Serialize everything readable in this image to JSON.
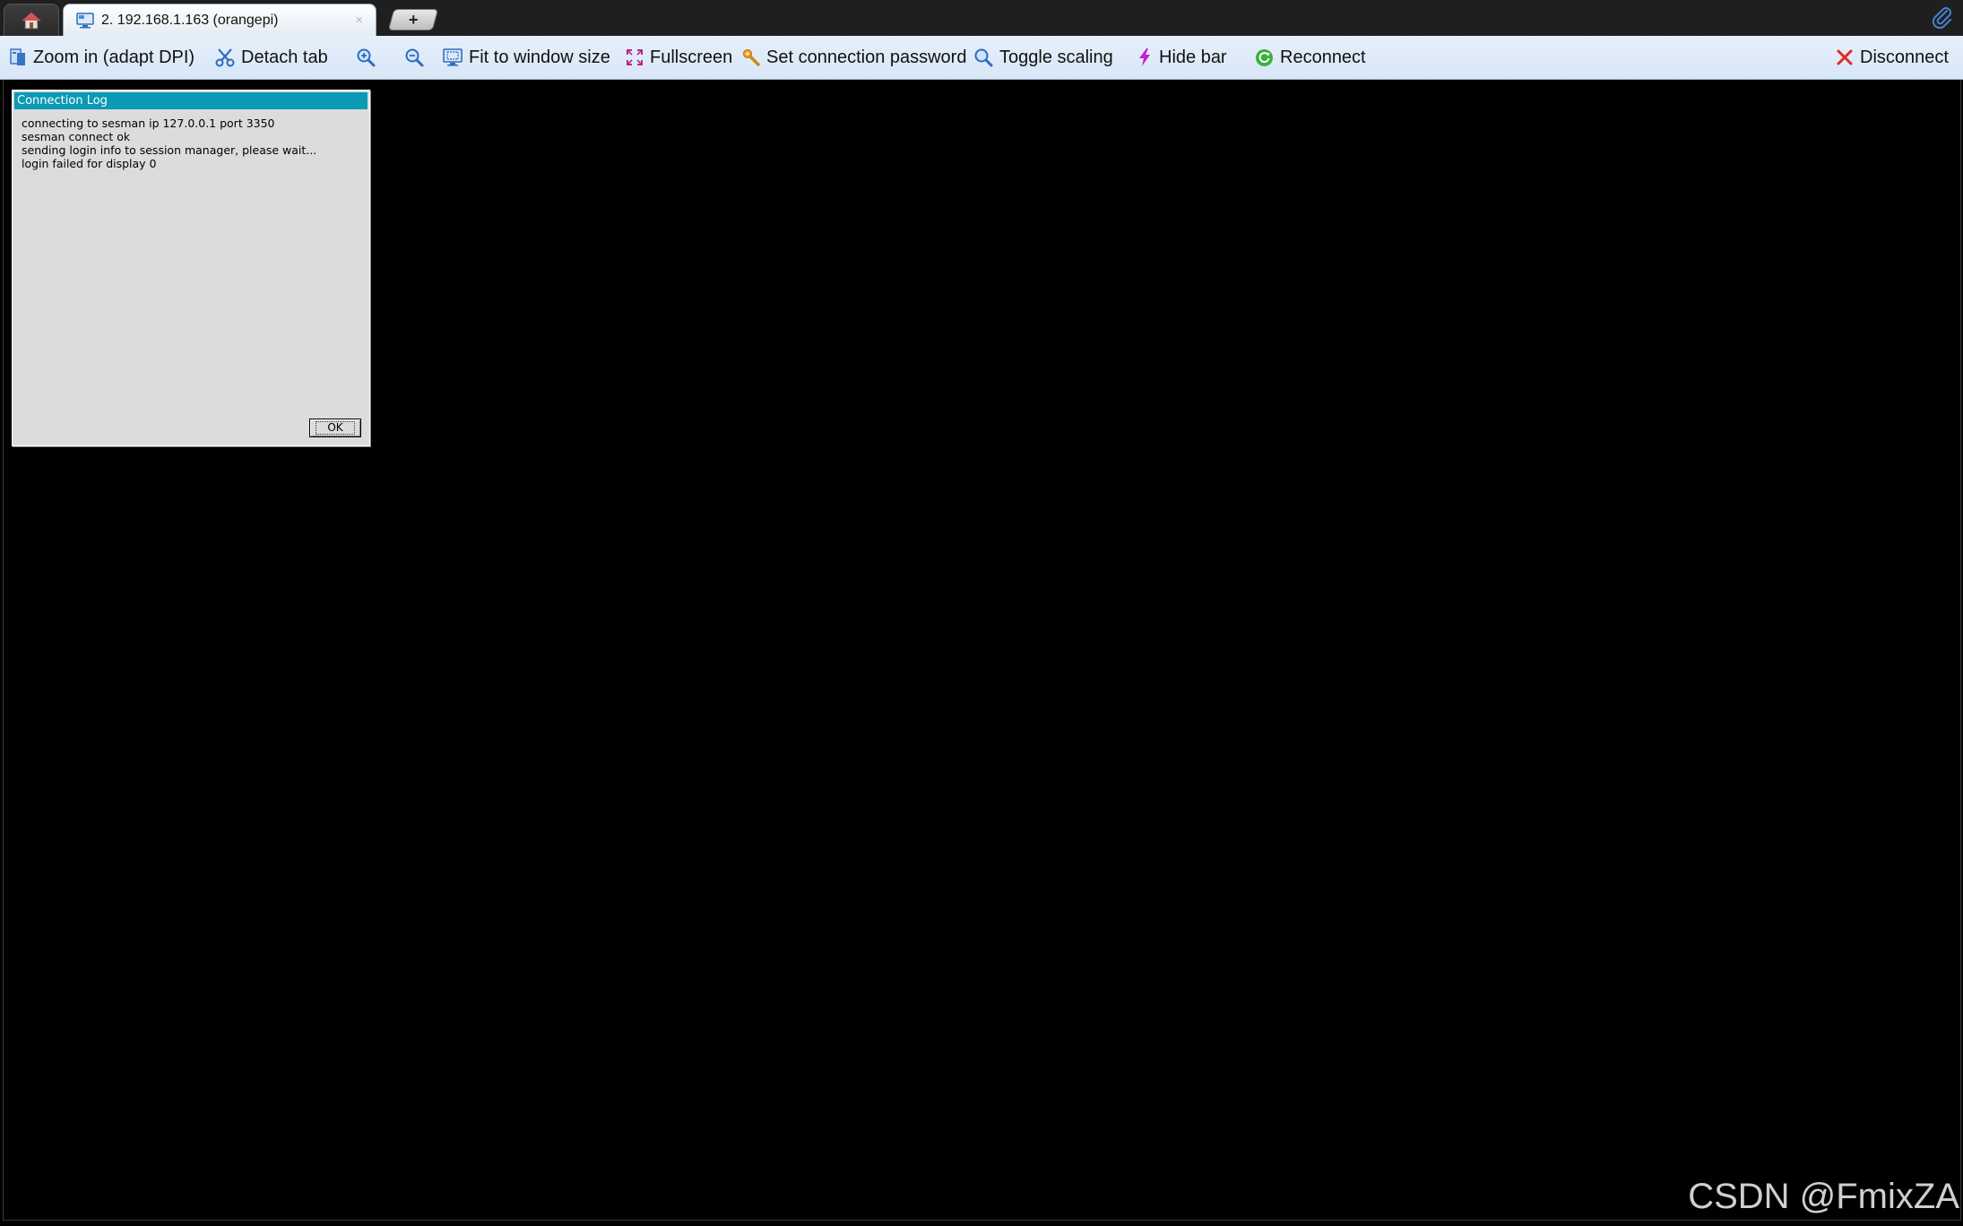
{
  "tabs": {
    "home_icon": "home-icon",
    "active_tab": {
      "icon": "remote-desktop-icon",
      "title": "2. 192.168.1.163 (orangepi)",
      "close_symbol": "×"
    },
    "new_tab_symbol": "+",
    "attachment_icon": "paperclip-icon"
  },
  "toolbar": {
    "zoom_in_adapt_dpi": "Zoom in (adapt DPI)",
    "detach_tab": "Detach tab",
    "fit_to_window_size": "Fit to window size",
    "fullscreen": "Fullscreen",
    "set_connection_password": "Set connection password",
    "toggle_scaling": "Toggle scaling",
    "hide_bar": "Hide bar",
    "reconnect": "Reconnect",
    "disconnect": "Disconnect"
  },
  "dialog": {
    "title": "Connection Log",
    "lines": [
      "connecting to sesman ip 127.0.0.1 port 3350",
      "sesman connect ok",
      "sending login info to session manager, please wait...",
      "login failed for display 0"
    ],
    "ok_label": "OK"
  },
  "watermark": "CSDN @FmixZA",
  "colors": {
    "dialog_title_bg": "#0a9ab4",
    "toolbar_bg": "#dfeaf8",
    "remote_bg": "#000000"
  }
}
